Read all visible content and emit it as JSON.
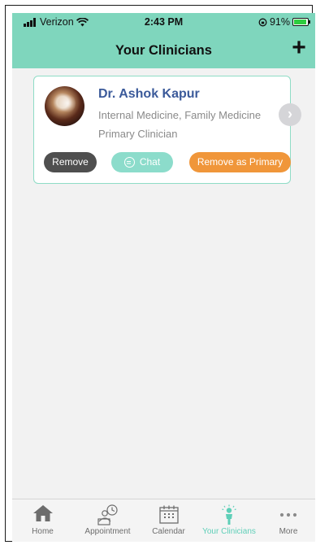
{
  "status": {
    "carrier": "Verizon",
    "time": "2:43 PM",
    "battery": "91%"
  },
  "header": {
    "title": "Your Clinicians",
    "add_label": "+"
  },
  "clinician": {
    "name": "Dr. Ashok Kapur",
    "specialties": "Internal Medicine, Family Medicine",
    "role": "Primary Clinician",
    "remove_label": "Remove",
    "chat_label": "Chat",
    "remove_primary_label": "Remove as Primary",
    "chevron": "›"
  },
  "tabs": [
    {
      "label": "Home",
      "icon": "home-icon"
    },
    {
      "label": "Appointment",
      "icon": "appointment-icon"
    },
    {
      "label": "Calendar",
      "icon": "calendar-icon"
    },
    {
      "label": "Your Clinicians",
      "icon": "clinician-icon",
      "active": true
    },
    {
      "label": "More",
      "icon": "more-icon"
    }
  ],
  "colors": {
    "accent": "#7fd6bd",
    "name": "#3b5a9a",
    "remove": "#4f4f4f",
    "chat": "#8cdccb",
    "primary": "#f0963a",
    "active_tab": "#5fcfb8"
  }
}
